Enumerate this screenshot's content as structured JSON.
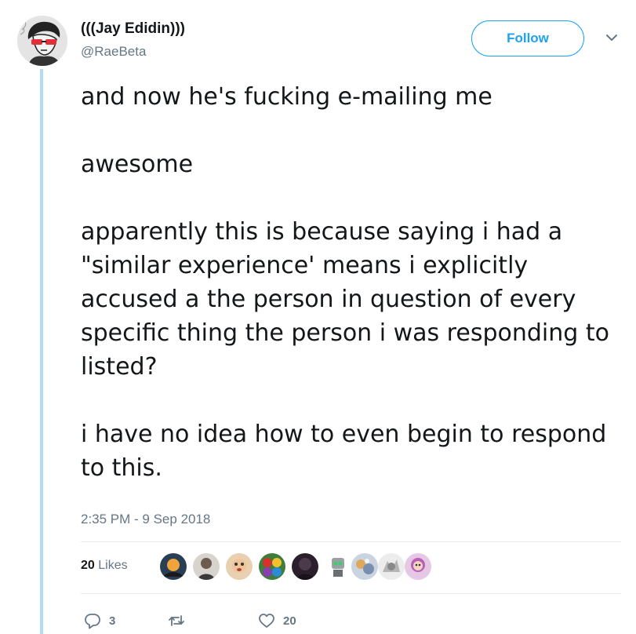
{
  "author": {
    "display_name": "(((Jay Edidin)))",
    "handle": "@RaeBeta"
  },
  "follow_button": {
    "label": "Follow"
  },
  "menu": {
    "icon": "chevron-down-icon"
  },
  "tweet": {
    "paragraphs": [
      "and now he's fucking e-mailing me",
      "awesome",
      "apparently this is because saying i had a \"similar experience' means i explicitly accused a the person in question of every specific thing the person i was responding to listed?",
      "i have no idea how to even begin to respond to this."
    ],
    "timestamp": "2:35 PM - 9 Sep 2018"
  },
  "likes": {
    "count": "20",
    "label": "Likes"
  },
  "actions": {
    "reply": {
      "icon": "reply-icon",
      "count": "3"
    },
    "retweet": {
      "icon": "retweet-icon",
      "count": ""
    },
    "like": {
      "icon": "heart-icon",
      "count": "20"
    }
  },
  "colors": {
    "accent": "#1da1f2",
    "thread_line": "#b3dbf7",
    "muted_text": "#657786",
    "primary_text": "#14171a",
    "divider": "#e6ecf0"
  }
}
